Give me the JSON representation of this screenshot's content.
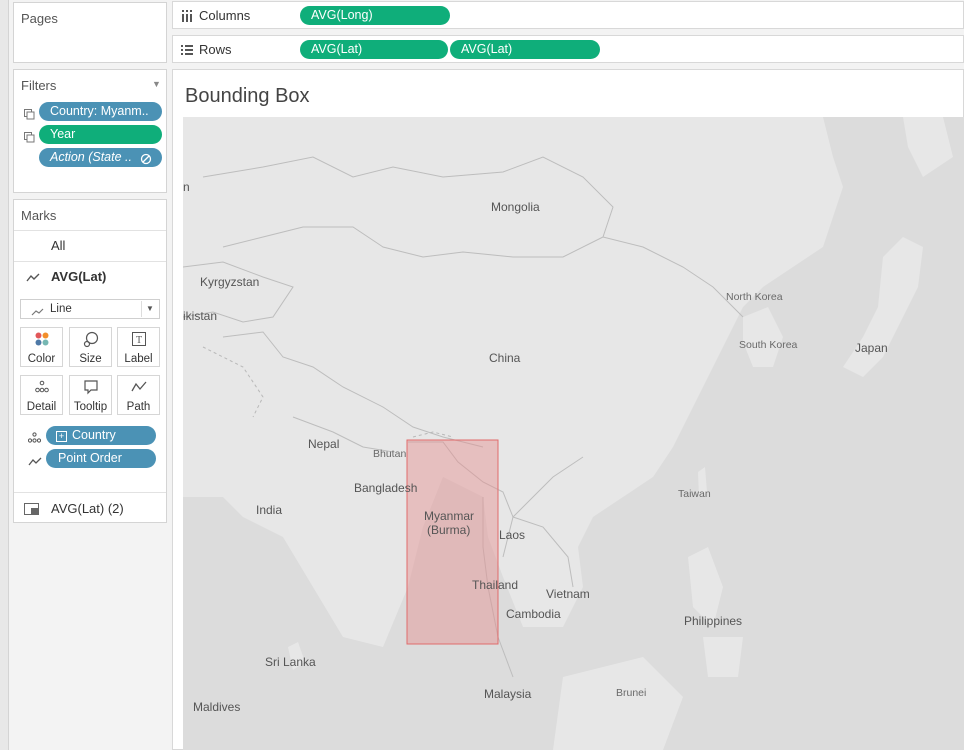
{
  "pages": {
    "title": "Pages"
  },
  "filters": {
    "title": "Filters",
    "items": [
      {
        "label": "Country: Myanm..",
        "style": "blue"
      },
      {
        "label": "Year",
        "style": "green"
      },
      {
        "label": "Action (State ..",
        "style": "blue-italic"
      }
    ]
  },
  "marks": {
    "title": "Marks",
    "all_label": "All",
    "layer_active": "AVG(Lat)",
    "mark_type": "Line",
    "buttons": {
      "color": "Color",
      "size": "Size",
      "label": "Label",
      "detail": "Detail",
      "tooltip": "Tooltip",
      "path": "Path"
    },
    "fields": [
      {
        "label": "Country",
        "icon": "detail-icon"
      },
      {
        "label": "Point Order",
        "icon": "path-icon"
      }
    ],
    "layer_secondary": "AVG(Lat) (2)"
  },
  "shelves": {
    "columns_label": "Columns",
    "rows_label": "Rows",
    "columns_pills": [
      "AVG(Long)"
    ],
    "rows_pills": [
      "AVG(Lat)",
      "AVG(Lat)"
    ]
  },
  "view": {
    "title": "Bounding Box",
    "map_labels": {
      "mongolia": "Mongolia",
      "kyrgyzstan": "Kyrgyzstan",
      "kistan": "ikistan",
      "n": "n",
      "china": "China",
      "north_korea": "North Korea",
      "south_korea": "South Korea",
      "japan": "Japan",
      "nepal": "Nepal",
      "bhutan": "Bhutan",
      "bangladesh": "Bangladesh",
      "india": "India",
      "myanmar_1": "Myanmar",
      "myanmar_2": "(Burma)",
      "laos": "Laos",
      "taiwan": "Taiwan",
      "thailand": "Thailand",
      "vietnam": "Vietnam",
      "cambodia": "Cambodia",
      "philippines": "Philippines",
      "sri_lanka": "Sri Lanka",
      "malaysia": "Malaysia",
      "brunei": "Brunei",
      "maldives": "Maldives"
    },
    "bbox_color": "#e48e8e"
  }
}
